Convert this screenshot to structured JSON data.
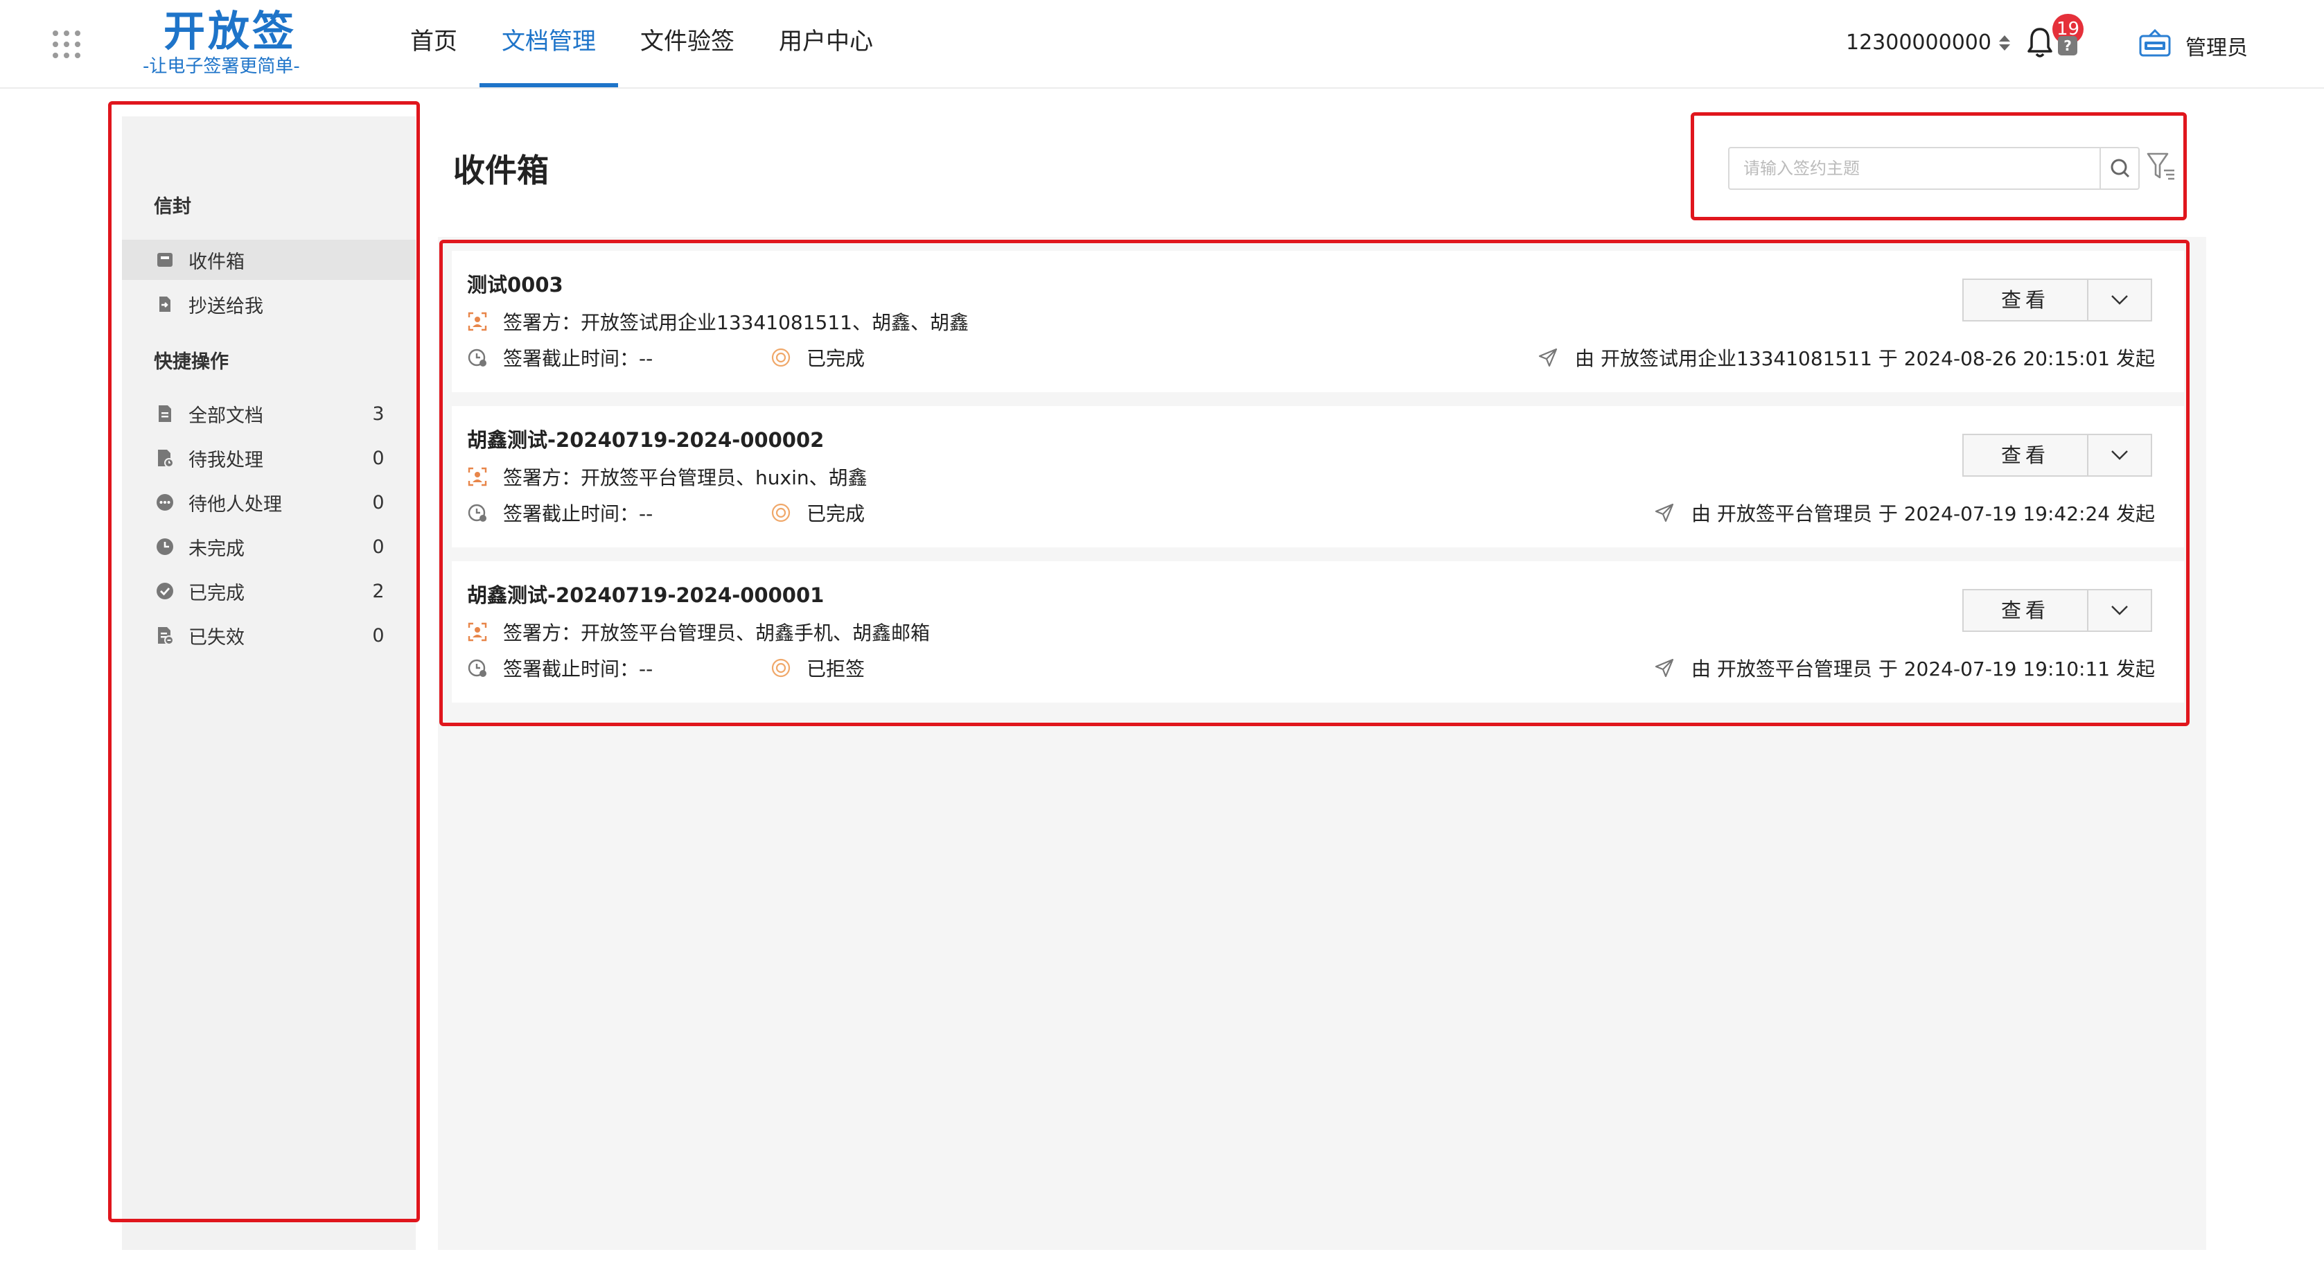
{
  "header": {
    "logo_title": "开放签",
    "logo_subtitle": "-让电子签署更简单-",
    "nav": [
      {
        "label": "首页",
        "active": false
      },
      {
        "label": "文档管理",
        "active": true
      },
      {
        "label": "文件验签",
        "active": false
      },
      {
        "label": "用户中心",
        "active": false
      }
    ],
    "phone": "12300000000",
    "notification_count": "19",
    "help_glyph": "?",
    "user_name": "管理员"
  },
  "sidebar": {
    "section_envelope": "信封",
    "envelope_items": [
      {
        "label": "收件箱",
        "icon": "inbox-icon",
        "active": true
      },
      {
        "label": "抄送给我",
        "icon": "cc-icon",
        "active": false
      }
    ],
    "section_quick": "快捷操作",
    "quick_items": [
      {
        "label": "全部文档",
        "count": "3",
        "icon": "document-icon"
      },
      {
        "label": "待我处理",
        "count": "0",
        "icon": "pending-me-icon"
      },
      {
        "label": "待他人处理",
        "count": "0",
        "icon": "pending-others-icon"
      },
      {
        "label": "未完成",
        "count": "0",
        "icon": "clock-icon"
      },
      {
        "label": "已完成",
        "count": "2",
        "icon": "check-circle-icon"
      },
      {
        "label": "已失效",
        "count": "0",
        "icon": "expired-icon"
      }
    ]
  },
  "main": {
    "title": "收件箱",
    "search_placeholder": "请输入签约主题",
    "view_label": "查看",
    "documents": [
      {
        "title": "测试0003",
        "signers": "签署方：开放签试用企业13341081511、胡鑫、胡鑫",
        "deadline": "签署截止时间：--",
        "status": "已完成",
        "initiator": "由 开放签试用企业13341081511 于 2024-08-26 20:15:01 发起"
      },
      {
        "title": "胡鑫测试-20240719-2024-000002",
        "signers": "签署方：开放签平台管理员、huxin、胡鑫",
        "deadline": "签署截止时间：--",
        "status": "已完成",
        "initiator": "由 开放签平台管理员 于 2024-07-19 19:42:24 发起"
      },
      {
        "title": "胡鑫测试-20240719-2024-000001",
        "signers": "签署方：开放签平台管理员、胡鑫手机、胡鑫邮箱",
        "deadline": "签署截止时间：--",
        "status": "已拒签",
        "initiator": "由 开放签平台管理员 于 2024-07-19 19:10:11 发起"
      }
    ]
  },
  "colors": {
    "brand_blue": "#1e74c9",
    "badge_red": "#e5303a",
    "annotation_red": "#e0161d",
    "signer_icon_orange": "#e8864a",
    "status_icon_orange": "#f0a86a"
  }
}
